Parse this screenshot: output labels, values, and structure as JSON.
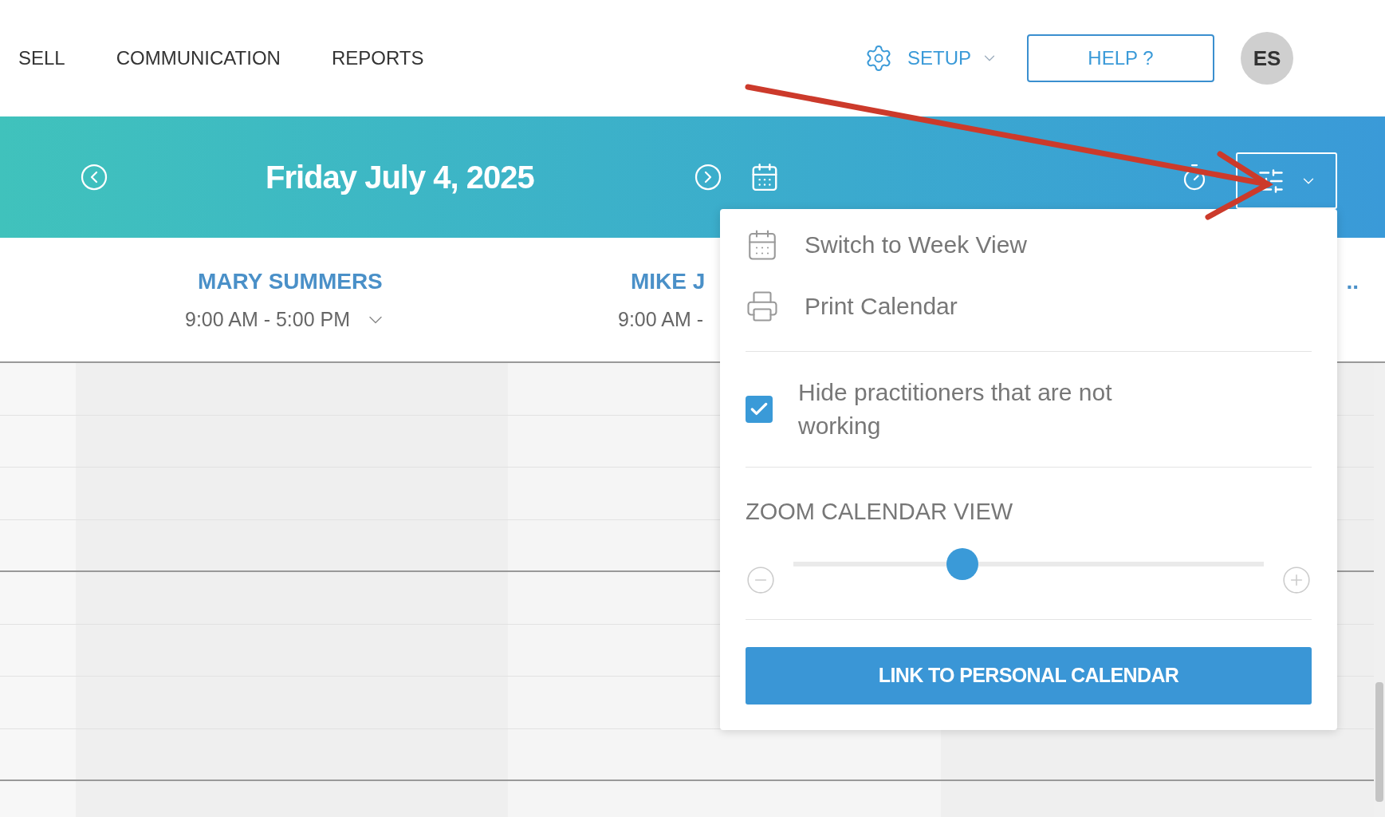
{
  "nav": {
    "items": [
      "SELL",
      "COMMUNICATION",
      "REPORTS"
    ],
    "setup": "SETUP",
    "help": "HELP ?",
    "avatar": "ES"
  },
  "date_bar": {
    "date": "Friday July 4, 2025"
  },
  "practitioners": [
    {
      "name": "MARY SUMMERS",
      "hours": "9:00 AM - 5:00 PM"
    },
    {
      "name": "MIKE J",
      "hours": "9:00 AM -"
    },
    {
      "name": ".."
    }
  ],
  "menu": {
    "items": [
      {
        "kind": "week",
        "label": "Switch to Week View"
      },
      {
        "kind": "print",
        "label": "Print Calendar"
      }
    ],
    "hide_not_working": {
      "label": "Hide practitioners that are not working",
      "checked": true
    },
    "zoom": {
      "label": "ZOOM CALENDAR VIEW",
      "level": 0.36
    },
    "link_button": "LINK TO PERSONAL CALENDAR"
  }
}
